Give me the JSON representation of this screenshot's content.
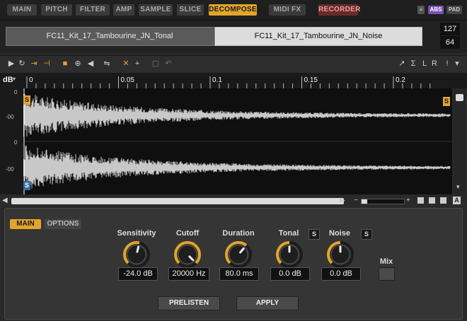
{
  "top_tabs": [
    {
      "label": "MAIN",
      "active": false
    },
    {
      "label": "PITCH",
      "active": false
    },
    {
      "label": "FILTER",
      "active": false
    },
    {
      "label": "AMP",
      "active": false
    },
    {
      "label": "SAMPLE",
      "active": false
    },
    {
      "label": "SLICE",
      "active": false
    },
    {
      "label": "DECOMPOSE",
      "active": true
    },
    {
      "label": "MIDI FX",
      "active": false
    },
    {
      "label": "RECORDER",
      "active": false
    }
  ],
  "top_right": {
    "abs": "ABS",
    "pad": "PAD"
  },
  "samples": {
    "tonal": "FC11_Kit_17_Tambourine_JN_Tonal",
    "noise": "FC11_Kit_17_Tambourine_JN_Noise"
  },
  "velocity": {
    "high": "127",
    "low": "64"
  },
  "ruler": {
    "unit": "dB",
    "ticks": [
      {
        "label": "0",
        "t": 0
      },
      {
        "label": "0.05",
        "t": 0.05
      },
      {
        "label": "0.1",
        "t": 0.1
      },
      {
        "label": "0.15",
        "t": 0.15
      },
      {
        "label": "0.2",
        "t": 0.2
      }
    ]
  },
  "db_scale": {
    "top": "0",
    "minus1": "-00",
    "zero": "0",
    "minus2": "-00"
  },
  "markers": {
    "start": "S",
    "end": "S",
    "bottom": "S"
  },
  "panel": {
    "tabs": [
      {
        "label": "MAIN",
        "active": true
      },
      {
        "label": "OPTIONS",
        "active": false
      }
    ],
    "knobs": [
      {
        "label": "Sensitivity",
        "value": "-24.0 dB",
        "level": 0.55
      },
      {
        "label": "Cutoff",
        "value": "20000 Hz",
        "level": 1.0
      },
      {
        "label": "Duration",
        "value": "80.0 ms",
        "level": 0.65
      },
      {
        "label": "Tonal",
        "value": "0.0 dB",
        "level": 0.5
      },
      {
        "label": "Noise",
        "value": "0.0 dB",
        "level": 0.5
      }
    ],
    "solo_label": "S",
    "mix_label": "Mix",
    "prelisten": "PRELISTEN",
    "apply": "APPLY"
  },
  "colors": {
    "accent": "#e2a42a",
    "waveform": "#c8c8c8",
    "background": "#0f0f0f"
  }
}
